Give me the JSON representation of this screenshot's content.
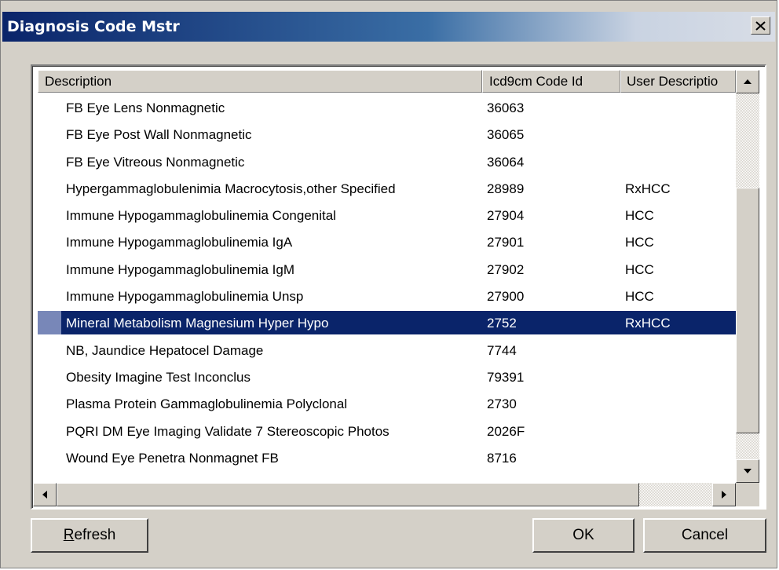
{
  "window": {
    "title": "Diagnosis Code Mstr",
    "close_glyph": "✕"
  },
  "list": {
    "columns": [
      "Description",
      "Icd9cm Code Id",
      "User Descriptio"
    ],
    "rows": [
      {
        "description": "FB Eye Lens Nonmagnetic",
        "code": "36063",
        "user": ""
      },
      {
        "description": "FB Eye Post Wall Nonmagnetic",
        "code": "36065",
        "user": ""
      },
      {
        "description": "FB Eye Vitreous Nonmagnetic",
        "code": "36064",
        "user": ""
      },
      {
        "description": "Hypergammaglobulenimia Macrocytosis,other Specified",
        "code": "28989",
        "user": "RxHCC"
      },
      {
        "description": "Immune Hypogammaglobulinemia Congenital",
        "code": "27904",
        "user": "HCC"
      },
      {
        "description": "Immune Hypogammaglobulinemia IgA",
        "code": "27901",
        "user": "HCC"
      },
      {
        "description": "Immune Hypogammaglobulinemia IgM",
        "code": "27902",
        "user": "HCC"
      },
      {
        "description": "Immune Hypogammaglobulinemia Unsp",
        "code": "27900",
        "user": "HCC"
      },
      {
        "description": "Mineral Metabolism Magnesium Hyper Hypo",
        "code": "2752",
        "user": "RxHCC"
      },
      {
        "description": "NB, Jaundice Hepatocel Damage",
        "code": "7744",
        "user": ""
      },
      {
        "description": "Obesity Imagine Test Inconclus",
        "code": "79391",
        "user": ""
      },
      {
        "description": "Plasma Protein Gammaglobulinemia Polyclonal",
        "code": "2730",
        "user": ""
      },
      {
        "description": "PQRI DM Eye Imaging Validate 7 Stereoscopic Photos",
        "code": "2026F",
        "user": ""
      },
      {
        "description": "Wound Eye Penetra Nonmagnet FB",
        "code": "8716",
        "user": ""
      }
    ],
    "selected_index": 8
  },
  "buttons": {
    "refresh_accel": "R",
    "refresh_rest": "efresh",
    "ok": "OK",
    "cancel": "Cancel"
  },
  "icons": {
    "scroll_up": "scroll-up-arrow-icon",
    "scroll_down": "scroll-down-arrow-icon",
    "scroll_left": "scroll-left-arrow-icon",
    "scroll_right": "scroll-right-arrow-icon"
  },
  "colors": {
    "selection": "#0a246a",
    "face": "#d4d0c8"
  }
}
